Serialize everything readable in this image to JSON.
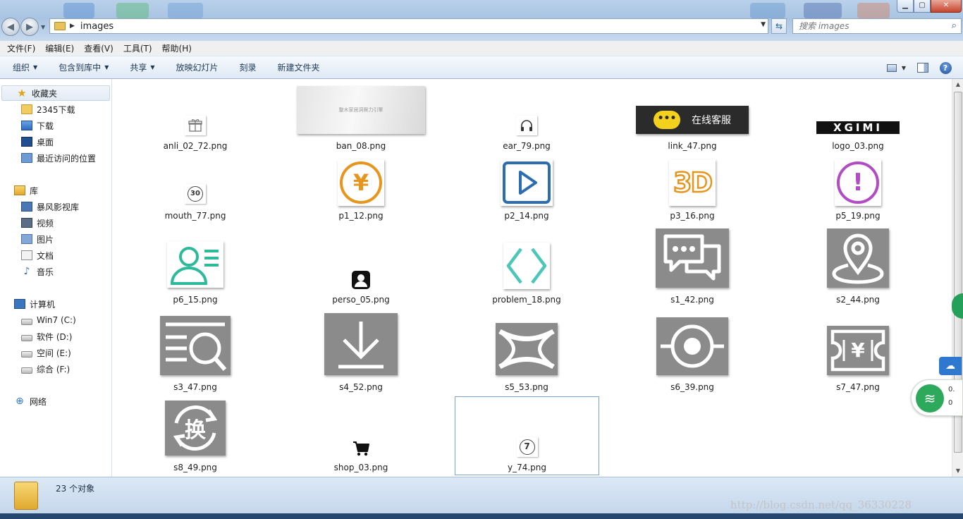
{
  "window": {
    "address_path": "images",
    "search_placeholder": "搜索 images"
  },
  "menu": [
    "文件(F)",
    "编辑(E)",
    "查看(V)",
    "工具(T)",
    "帮助(H)"
  ],
  "toolbar": {
    "organize": "组织",
    "include_in_library": "包含到库中",
    "share": "共享",
    "slideshow": "放映幻灯片",
    "burn": "刻录",
    "new_folder": "新建文件夹"
  },
  "sidebar": {
    "favorites": {
      "label": "收藏夹",
      "items": [
        "2345下载",
        "下载",
        "桌面",
        "最近访问的位置"
      ]
    },
    "libraries": {
      "label": "库",
      "items": [
        "暴风影视库",
        "视频",
        "图片",
        "文档",
        "音乐"
      ]
    },
    "computer": {
      "label": "计算机",
      "items": [
        "Win7 (C:)",
        "软件 (D:)",
        "空间 (E:)",
        "综合 (F:)"
      ]
    },
    "network": {
      "label": "网络"
    }
  },
  "files": [
    {
      "name": "anli_02_72.png",
      "icon": "gift-icon"
    },
    {
      "name": "ban_08.png",
      "icon": "banner-thumbnail",
      "text": "整木家居洞察力引擎"
    },
    {
      "name": "ear_79.png",
      "icon": "headphones-icon"
    },
    {
      "name": "link_47.png",
      "icon": "chat-bubble-icon",
      "text": "在线客服"
    },
    {
      "name": "logo_03.png",
      "icon": "xgimi-logo",
      "text": "XGIMI"
    },
    {
      "name": "mouth_77.png",
      "icon": "circle-30-icon",
      "text": "30"
    },
    {
      "name": "p1_12.png",
      "icon": "yen-circle-icon",
      "text": "¥"
    },
    {
      "name": "p2_14.png",
      "icon": "play-icon"
    },
    {
      "name": "p3_16.png",
      "icon": "3d-icon",
      "text": "3D"
    },
    {
      "name": "p5_19.png",
      "icon": "exclamation-circle-icon",
      "text": "!"
    },
    {
      "name": "p6_15.png",
      "icon": "person-card-icon"
    },
    {
      "name": "perso_05.png",
      "icon": "person-icon"
    },
    {
      "name": "problem_18.png",
      "icon": "diamond-outline-icon"
    },
    {
      "name": "s1_42.png",
      "icon": "chat-dots-icon"
    },
    {
      "name": "s2_44.png",
      "icon": "location-pin-icon"
    },
    {
      "name": "s3_47.png",
      "icon": "search-list-icon"
    },
    {
      "name": "s4_52.png",
      "icon": "download-arrow-icon"
    },
    {
      "name": "s5_53.png",
      "icon": "x-shape-icon"
    },
    {
      "name": "s6_39.png",
      "icon": "target-ring-icon"
    },
    {
      "name": "s7_47.png",
      "icon": "yen-ticket-icon",
      "text": "¥"
    },
    {
      "name": "s8_49.png",
      "icon": "exchange-circle-icon",
      "text": "换"
    },
    {
      "name": "shop_03.png",
      "icon": "shopping-cart-icon"
    },
    {
      "name": "y_74.png",
      "icon": "circle-7-icon",
      "text": "7"
    }
  ],
  "status": {
    "count": "23 个对象"
  },
  "watermark": "http://blog.csdn.net/qq_36330228",
  "widgets": {
    "wifi_text1": "0.",
    "wifi_text2": "0"
  },
  "colors": {
    "accent": "#2f78cf",
    "gray_icon": "#8b8b8b",
    "orange": "#e7951c",
    "blue": "#2c6db2",
    "purple": "#b24cc4",
    "teal": "#2cba9a"
  }
}
